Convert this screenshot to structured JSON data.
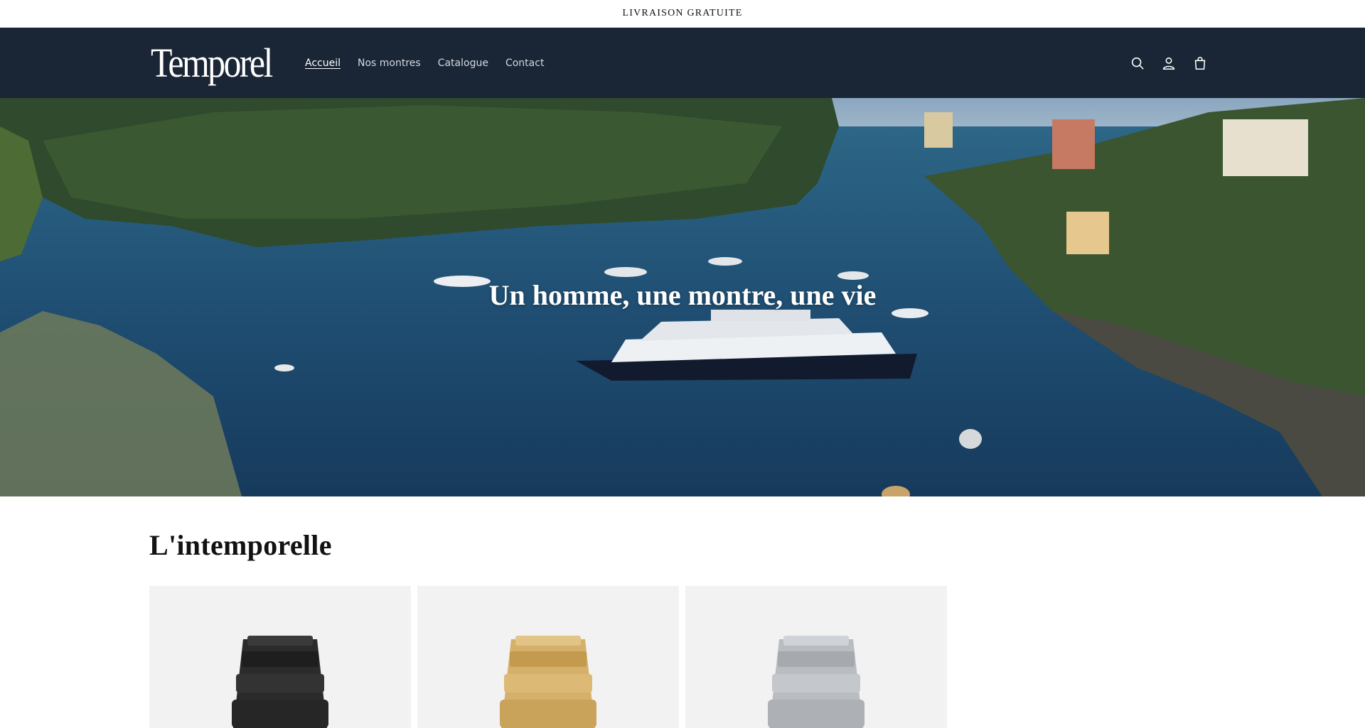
{
  "announcement": {
    "text": "LIVRAISON GRATUITE"
  },
  "header": {
    "logo": "Temporel",
    "nav": [
      {
        "label": "Accueil",
        "active": true
      },
      {
        "label": "Nos montres",
        "active": false
      },
      {
        "label": "Catalogue",
        "active": false
      },
      {
        "label": "Contact",
        "active": false
      }
    ],
    "icons": [
      "search-icon",
      "account-icon",
      "cart-icon"
    ],
    "background": "#1a2535"
  },
  "hero": {
    "title": "Un homme, une montre, une vie"
  },
  "collection": {
    "title": "L'intemporelle",
    "products": [
      {
        "variant": "black",
        "color": "#2b2b2b"
      },
      {
        "variant": "gold",
        "color": "#d4b06a"
      },
      {
        "variant": "silver",
        "color": "#b9bcc0"
      }
    ]
  }
}
